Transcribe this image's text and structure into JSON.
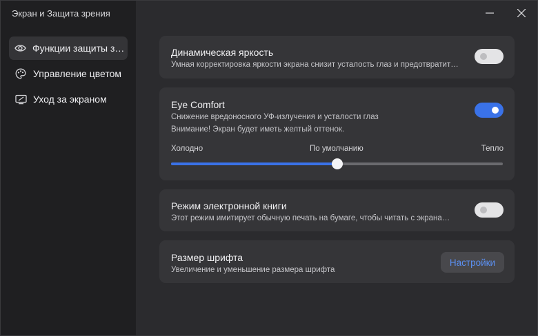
{
  "app": {
    "title": "Экран и Защита зрения"
  },
  "sidebar": {
    "items": [
      {
        "label": "Функции защиты зрения",
        "icon": "eye-icon",
        "active": true
      },
      {
        "label": "Управление цветом",
        "icon": "palette-icon",
        "active": false
      },
      {
        "label": "Уход за экраном",
        "icon": "monitor-icon",
        "active": false
      }
    ]
  },
  "window_controls": {
    "minimize": "minimize-icon",
    "close": "close-icon"
  },
  "cards": {
    "dynamic_brightness": {
      "title": "Динамическая яркость",
      "desc": "Умная корректировка яркости экрана снизит усталость глаз и предотвратит…",
      "enabled": false
    },
    "eye_comfort": {
      "title": "Eye Comfort",
      "desc1": "Снижение вредоносного УФ-излучения и усталости глаз",
      "desc2": "Внимание! Экран будет иметь желтый оттенок.",
      "enabled": true,
      "slider": {
        "left_label": "Холодно",
        "center_label": "По умолчанию",
        "right_label": "Тепло",
        "value": 0.5
      }
    },
    "ebook_mode": {
      "title": "Режим электронной книги",
      "desc": "Этот режим имитирует обычную печать на бумаге, чтобы читать с экрана…",
      "enabled": false
    },
    "font_size": {
      "title": "Размер шрифта",
      "desc": "Увеличение и уменьшение размера шрифта",
      "button_label": "Настройки"
    }
  },
  "colors": {
    "accent": "#3a72e8",
    "link": "#5b8ff0",
    "card_bg": "#353538",
    "sidebar_bg": "#1f1f21"
  }
}
